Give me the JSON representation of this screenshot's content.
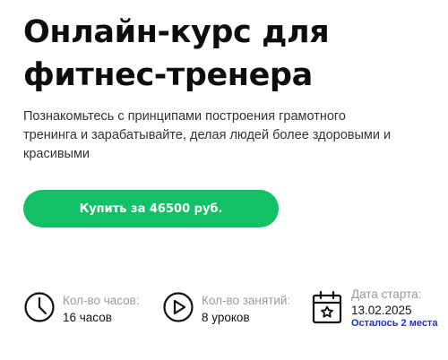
{
  "course": {
    "title_line1": "Онлайн-курс для",
    "title_line2": "фитнес-тренера",
    "description": "Познакомьтесь с принципами построения грамотного тренинга и зарабатывайте, делая людей более здоровыми и красивыми",
    "buy_button_label": "Купить за 46500 руб.",
    "accent_color": "#12c065"
  },
  "stats": {
    "hours": {
      "icon": "clock-icon",
      "label": "Кол-во часов:",
      "value": "16 часов"
    },
    "lessons": {
      "icon": "play-icon",
      "label": "Кол-во занятий:",
      "value": "8 уроков"
    },
    "start": {
      "icon": "calendar-star-icon",
      "label": "Дата старта:",
      "value": "13.02.2025",
      "note": "Осталось 2 места",
      "note_color": "#1f2fd6"
    }
  }
}
